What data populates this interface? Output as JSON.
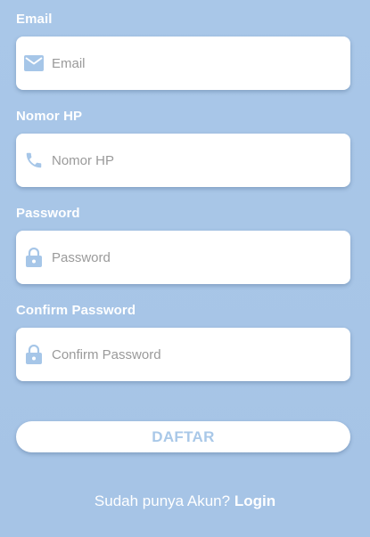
{
  "form": {
    "fields": [
      {
        "label": "Email",
        "placeholder": "Email",
        "value": "",
        "icon": "mail-icon"
      },
      {
        "label": "Nomor HP",
        "placeholder": "Nomor HP",
        "value": "",
        "icon": "phone-icon"
      },
      {
        "label": "Password",
        "placeholder": "Password",
        "value": "",
        "icon": "lock-icon"
      },
      {
        "label": "Confirm Password",
        "placeholder": "Confirm Password",
        "value": "",
        "icon": "lock-icon"
      }
    ],
    "submit_label": "DAFTAR"
  },
  "footer": {
    "prompt": "Sudah punya Akun?",
    "login_label": "Login"
  },
  "colors": {
    "background": "#a9c7e8",
    "card": "#ffffff",
    "icon": "#a6c6e8",
    "button_text": "#a9c8e8",
    "label_text": "#ffffff"
  }
}
